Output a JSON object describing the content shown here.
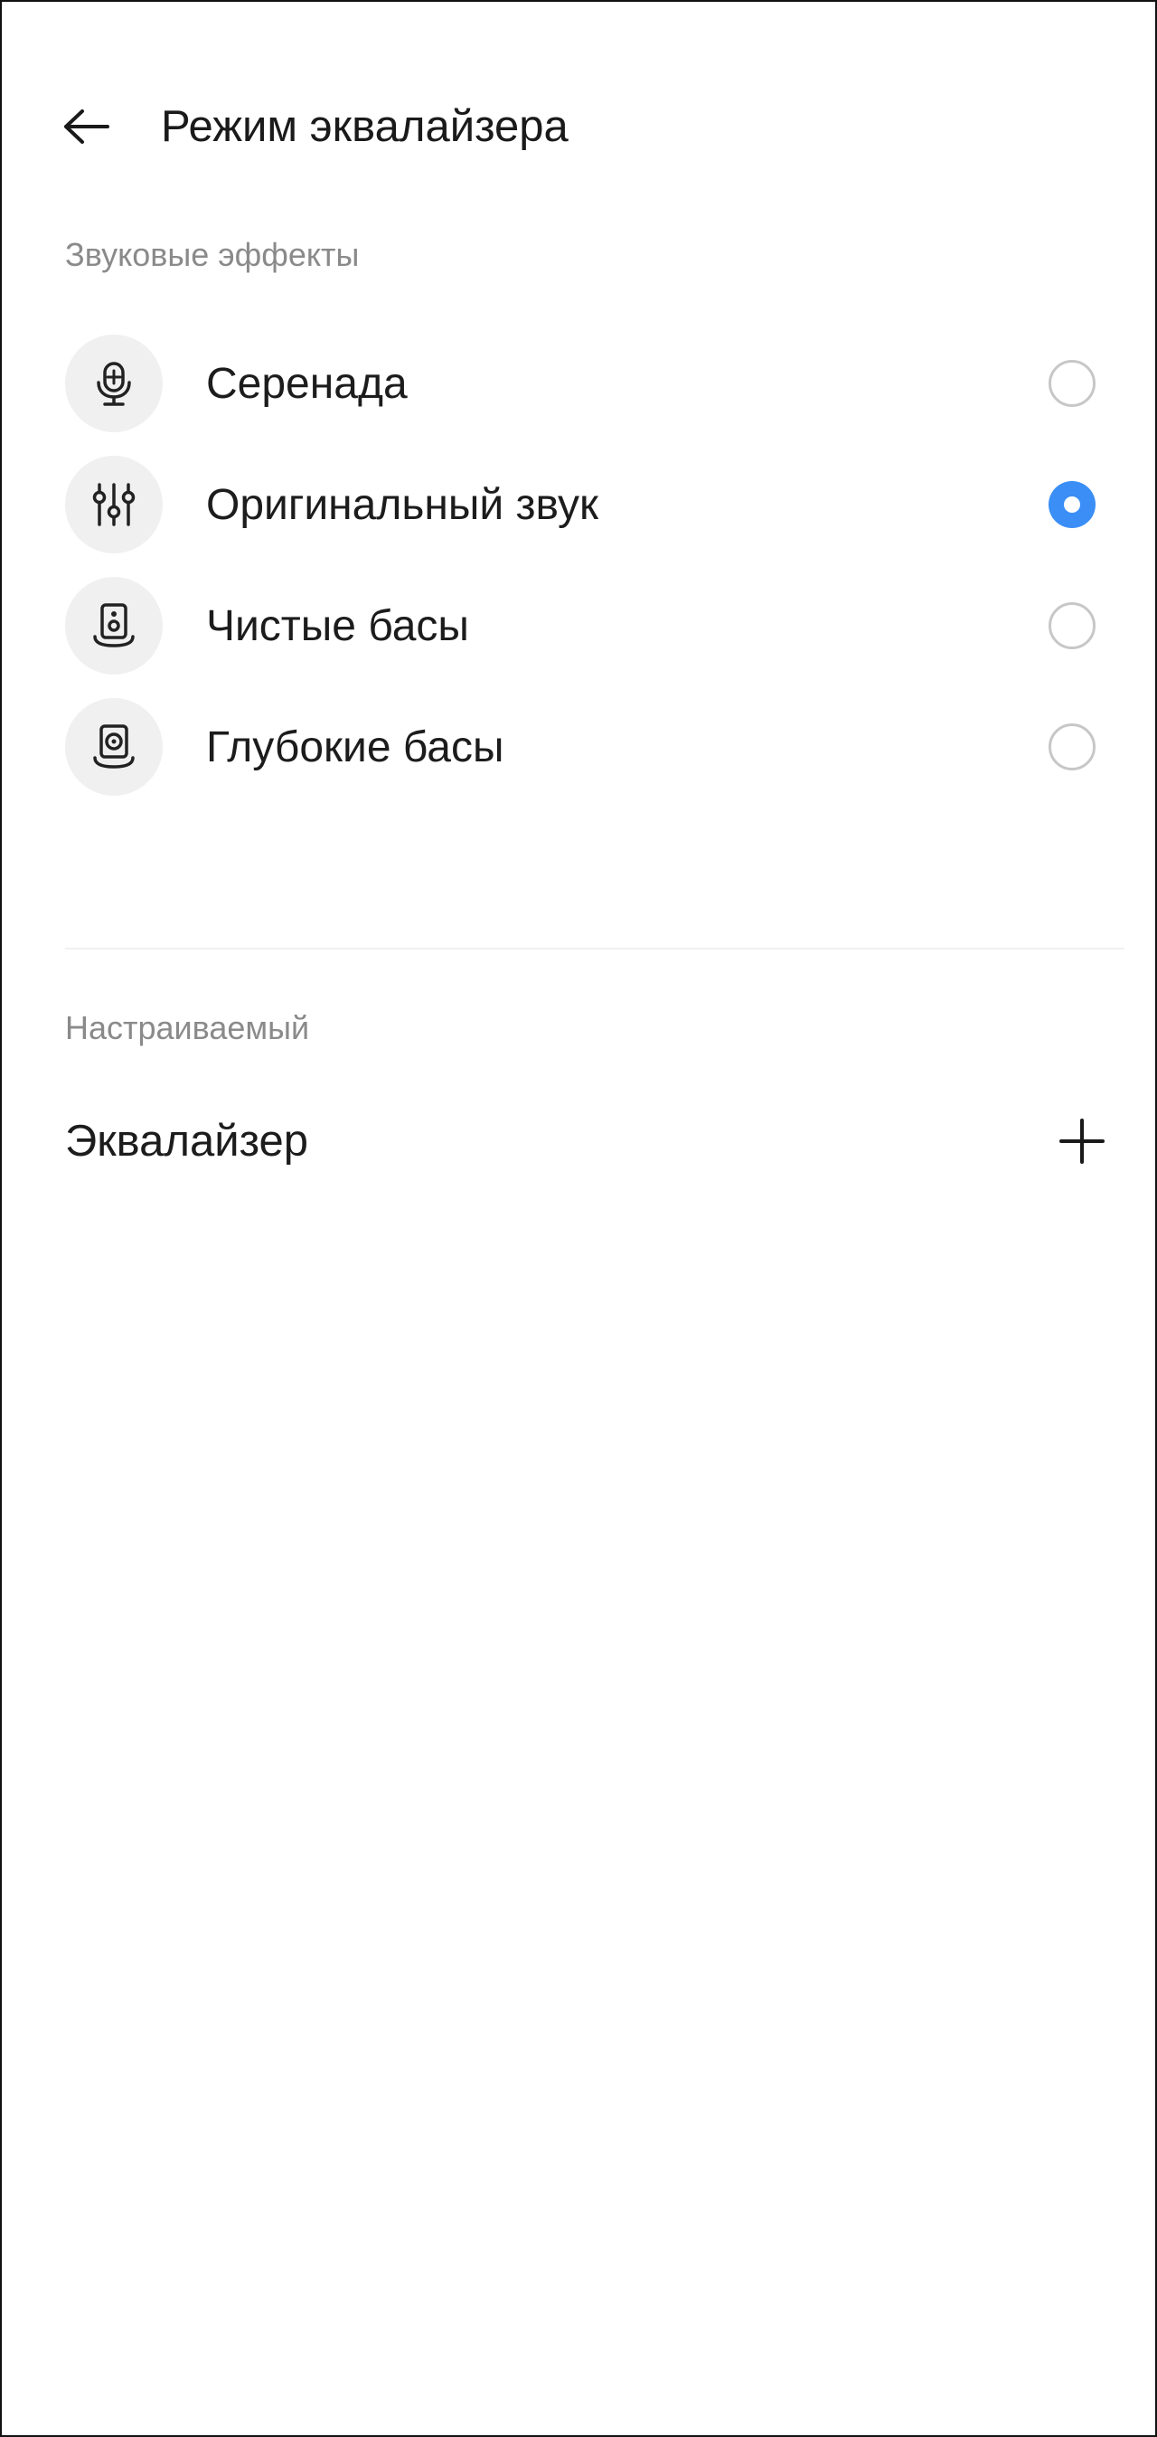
{
  "header": {
    "back_icon": "arrow-left-icon",
    "title": "Режим эквалайзера"
  },
  "sound_effects": {
    "section_label": "Звуковые эффекты",
    "items": [
      {
        "label": "Серенада",
        "icon": "microphone-icon",
        "selected": false
      },
      {
        "label": "Оригинальный звук",
        "icon": "sliders-icon",
        "selected": true
      },
      {
        "label": "Чистые басы",
        "icon": "speaker-icon",
        "selected": false
      },
      {
        "label": "Глубокие басы",
        "icon": "speaker-bass-icon",
        "selected": false
      }
    ]
  },
  "custom": {
    "section_label": "Настраиваемый",
    "equalizer_label": "Эквалайзер",
    "add_icon": "plus-icon"
  },
  "colors": {
    "accent": "#3a8ef6",
    "text_primary": "#1c1c1c",
    "text_secondary": "#8a8a8a",
    "icon_bg": "#f0f0f0",
    "radio_border": "#c7c7c7"
  }
}
